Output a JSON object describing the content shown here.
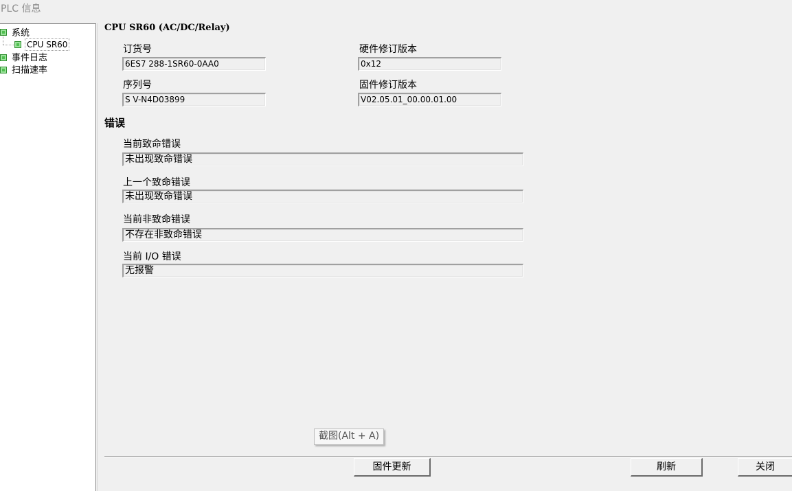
{
  "window": {
    "title": "PLC 信息"
  },
  "tree": {
    "items": [
      {
        "label": "系统"
      },
      {
        "label": "CPU SR60"
      },
      {
        "label": "事件日志"
      },
      {
        "label": "扫描速率"
      }
    ]
  },
  "cpu": {
    "title": "CPU SR60 (AC/DC/Relay)",
    "order_no_label": "订货号",
    "order_no_value": "6ES7 288-1SR60-0AA0",
    "hw_rev_label": "硬件修订版本",
    "hw_rev_value": "0x12",
    "serial_label": "序列号",
    "serial_value": "S V-N4D03899",
    "fw_rev_label": "固件修订版本",
    "fw_rev_value": "V02.05.01_00.00.01.00"
  },
  "errors": {
    "heading": "错误",
    "current_fatal_label": "当前致命错误",
    "current_fatal_value": "未出现致命错误",
    "last_fatal_label": "上一个致命错误",
    "last_fatal_value": "未出现致命错误",
    "current_nonfatal_label": "当前非致命错误",
    "current_nonfatal_value": "不存在非致命错误",
    "current_io_label": "当前 I/O 错误",
    "current_io_value": "无报警"
  },
  "tooltip": {
    "text": "截图(Alt + A)"
  },
  "buttons": {
    "firmware_update": "固件更新",
    "refresh": "刷新",
    "close": "关闭"
  },
  "colors": {
    "node_green": "#4fbf4f",
    "background": "#f0f0f0"
  }
}
